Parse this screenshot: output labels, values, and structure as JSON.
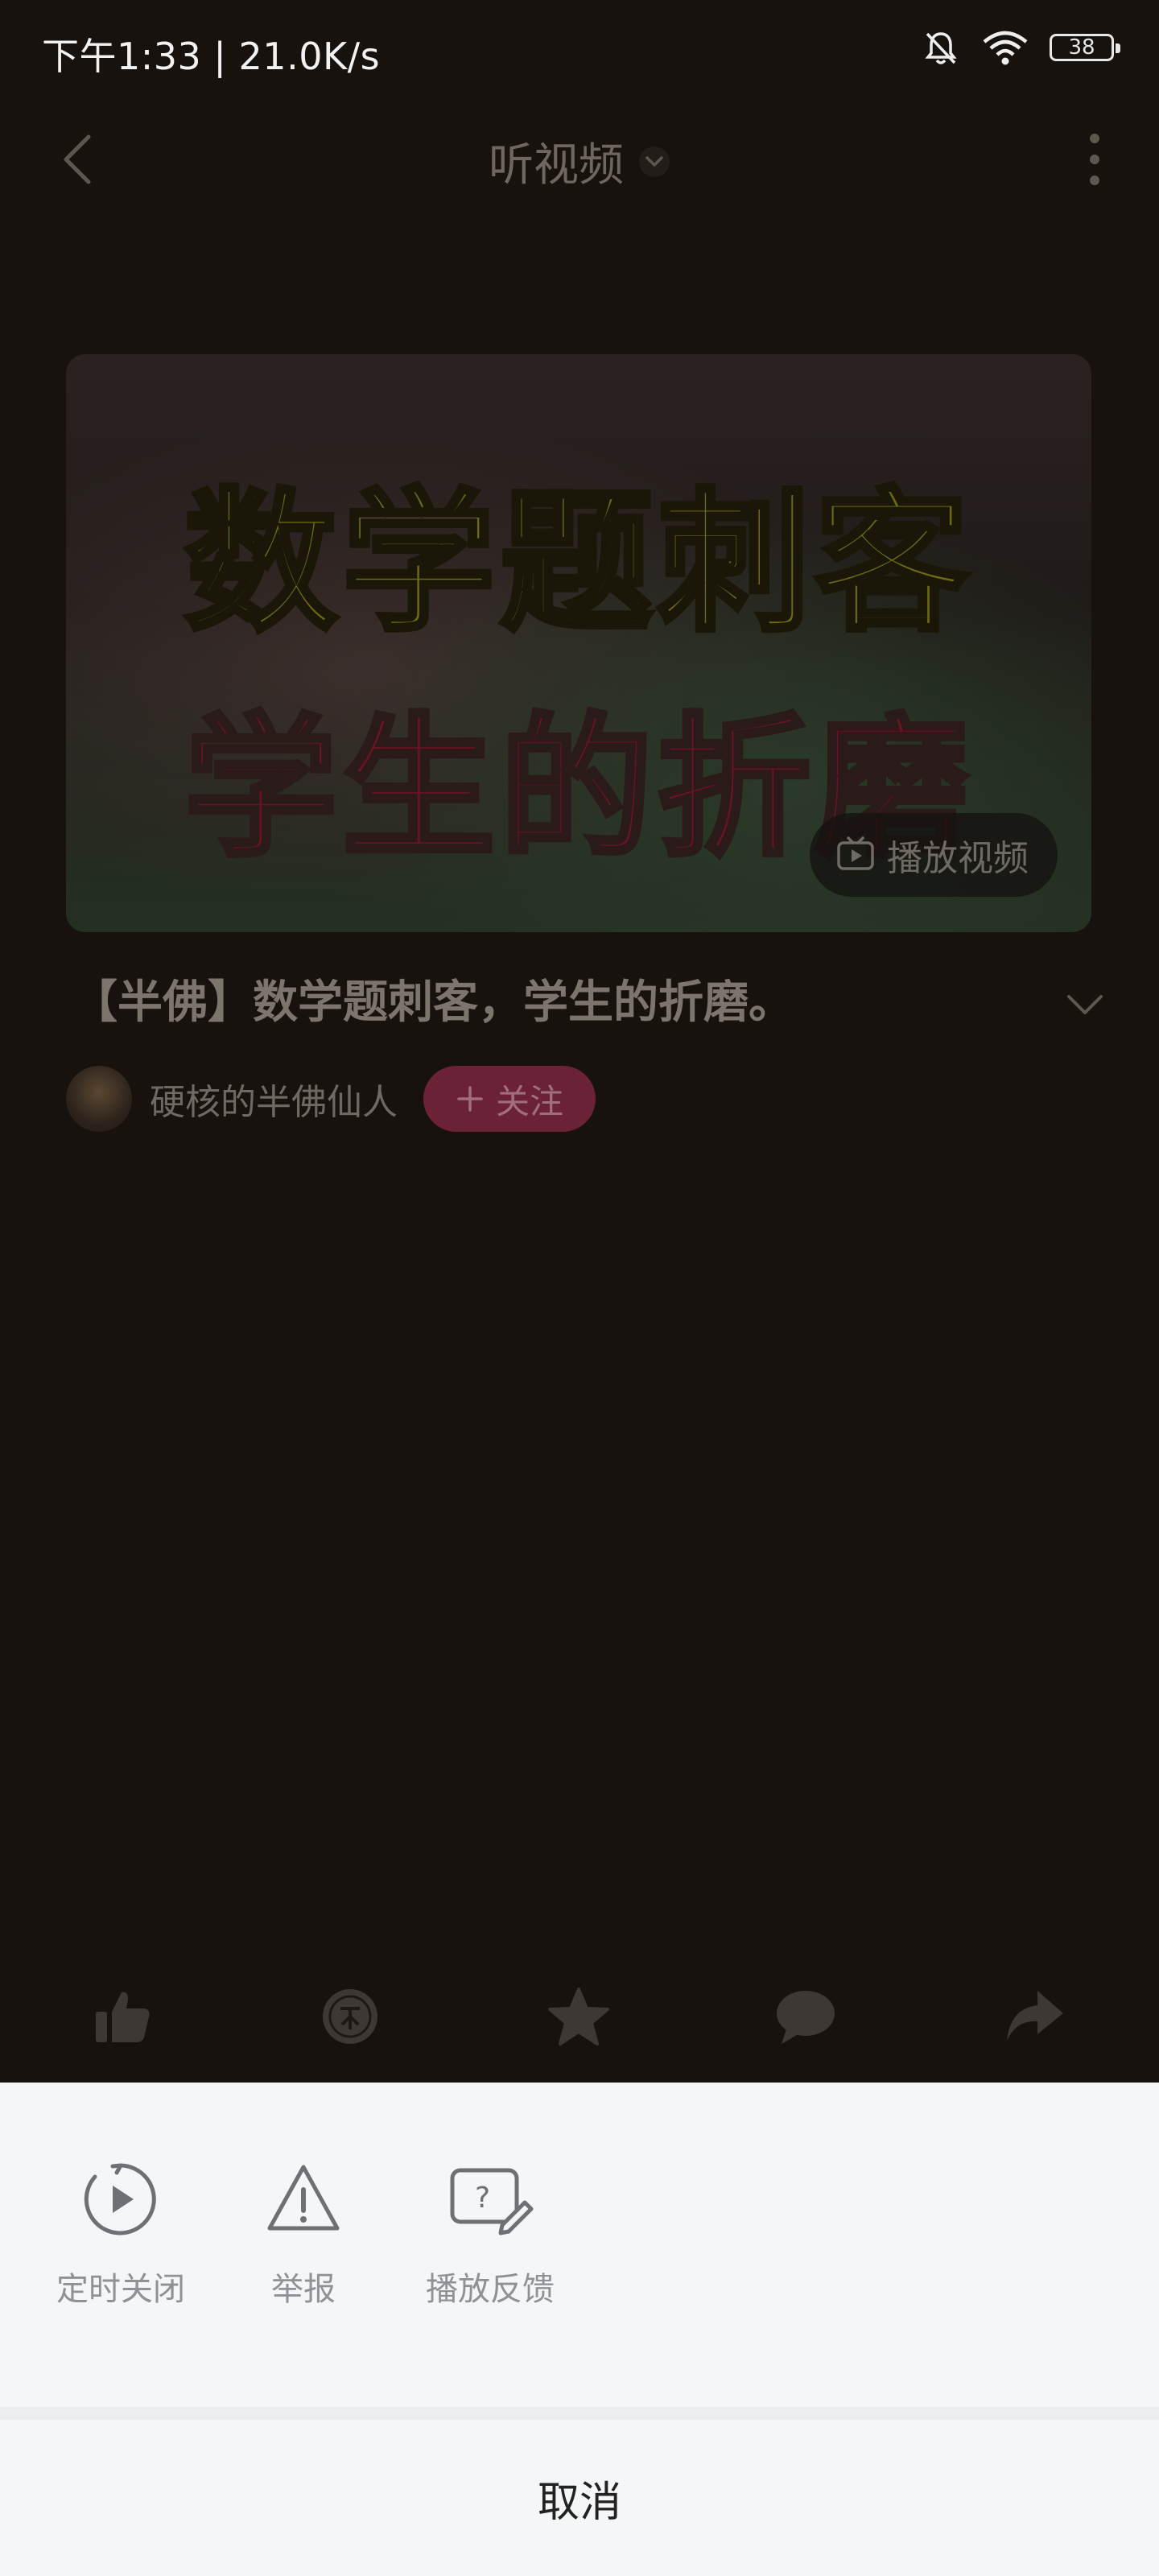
{
  "status_bar": {
    "time": "下午1:33 | 21.0K/s",
    "battery": "38"
  },
  "header": {
    "title": "听视频"
  },
  "video": {
    "thumbnail_line1": "数学题刺客",
    "thumbnail_line2": "学生的折磨",
    "play_label": "播放视频"
  },
  "info": {
    "title": "【半佛】数学题刺客，学生的折磨。",
    "author": "硬核的半佛仙人",
    "follow_label": "关注"
  },
  "actions": [
    "like-icon",
    "coin-icon",
    "favorite-icon",
    "comment-icon",
    "share-icon"
  ],
  "sheet": {
    "options": [
      {
        "label": "定时关闭",
        "icon": "timer-play-icon"
      },
      {
        "label": "举报",
        "icon": "warning-icon"
      },
      {
        "label": "播放反馈",
        "icon": "feedback-icon"
      }
    ],
    "cancel": "取消"
  }
}
